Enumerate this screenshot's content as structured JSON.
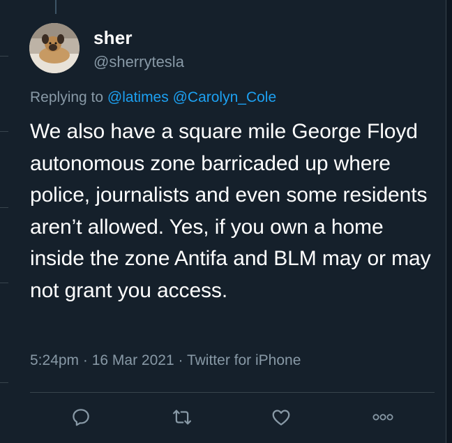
{
  "tweet": {
    "author": {
      "display_name": "sher",
      "handle": "@sherrytesla",
      "avatar_icon": "avatar-dog-photo"
    },
    "replying_prefix": "Replying to",
    "reply_mentions": [
      "@latimes",
      "@Carolyn_Cole"
    ],
    "text": "We also have a square mile George Floyd autonomous zone barricaded up where police, journalists and even some residents aren’t allowed. Yes, if you own a home inside the zone Antifa and BLM may or may not grant you access.",
    "time": "5:24pm",
    "date": "16 Mar 2021",
    "source": "Twitter for iPhone",
    "separator": "·"
  },
  "actions": [
    {
      "name": "reply",
      "icon": "reply-icon"
    },
    {
      "name": "retweet",
      "icon": "retweet-icon"
    },
    {
      "name": "like",
      "icon": "heart-icon"
    },
    {
      "name": "more",
      "icon": "more-icon"
    }
  ],
  "colors": {
    "background": "#15202b",
    "text": "#ffffff",
    "secondary": "#8899a6",
    "link": "#1da1f2",
    "divider": "#38444d"
  }
}
